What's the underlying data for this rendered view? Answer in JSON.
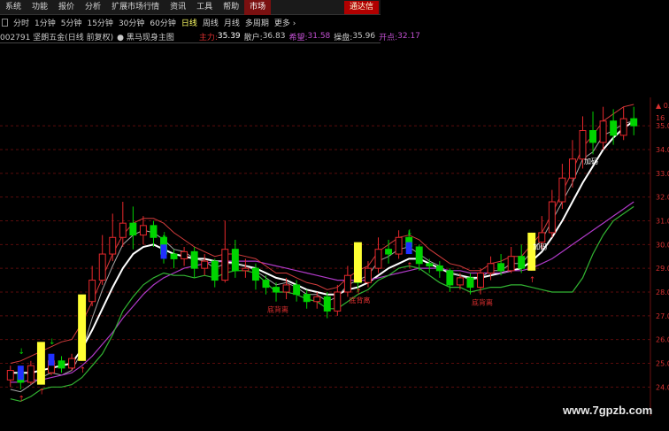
{
  "menu": {
    "items": [
      "系统",
      "功能",
      "报价",
      "分析",
      "扩展市场行情",
      "资讯",
      "工具",
      "帮助"
    ],
    "active": "市场",
    "right_link": "通达信"
  },
  "periods": {
    "items": [
      "分时",
      "1分钟",
      "5分钟",
      "15分钟",
      "30分钟",
      "60分钟",
      "日线",
      "周线",
      "月线",
      "多周期",
      "更多"
    ],
    "selected": "日线"
  },
  "info": {
    "code_name": "002791 坚朗五金(日线 前复权)",
    "indicator": "黑马现身主图",
    "zhuli_label": "主力:",
    "zhuli_value": "35.39",
    "sanhu_label": "散户:",
    "sanhu_value": "36.83",
    "xiwang_label": "希望:",
    "xiwang_value": "31.58",
    "caopan_label": "操盘:",
    "caopan_value": "35.96",
    "kaidian_label": "开点:",
    "kaidian_value": "32.17"
  },
  "colors": {
    "up": "#e8282c",
    "down": "#00d400",
    "highlight": "#ffff33",
    "main_line": "#ffffff",
    "mid_line": "#a9a9a9",
    "purple_line": "#b03ac8",
    "green_line": "#32b432",
    "red_line": "#d23c3c"
  },
  "chart_data": {
    "type": "candlestick",
    "ylim": [
      23.9,
      35.9
    ],
    "y_ticks": [
      "35.0",
      "34.0",
      "33.0",
      "32.0",
      "31.0",
      "30.0",
      "29.0",
      "28.0",
      "27.0",
      "26.0",
      "25.0",
      "24.0"
    ],
    "y_tick_values": [
      35,
      34,
      33,
      32,
      31,
      30,
      29,
      28,
      27,
      26,
      25,
      24
    ],
    "top_right_ticks": [
      "0.40",
      "16"
    ],
    "annotations": [
      {
        "text": "底背离",
        "i": 26
      },
      {
        "text": "底背离",
        "i": 34
      },
      {
        "text": "底背离",
        "i": 46
      },
      {
        "text": "加码",
        "i": 57
      },
      {
        "text": "加码",
        "i": 52
      }
    ],
    "candles": [
      [
        24.3,
        24.7,
        24.0,
        24.9
      ],
      [
        24.6,
        24.2,
        23.9,
        24.8
      ],
      [
        24.2,
        24.9,
        24.1,
        25.1
      ],
      [
        24.9,
        24.6,
        24.4,
        25.1
      ],
      [
        24.6,
        25.1,
        24.5,
        25.3
      ],
      [
        25.1,
        24.8,
        24.6,
        25.3
      ],
      [
        24.8,
        25.2,
        24.7,
        25.4
      ],
      [
        25.2,
        27.6,
        25.1,
        27.8
      ],
      [
        27.6,
        28.5,
        27.4,
        29.1
      ],
      [
        28.5,
        29.6,
        28.3,
        30.4
      ],
      [
        29.6,
        30.3,
        29.3,
        31.3
      ],
      [
        30.3,
        30.9,
        29.9,
        31.8
      ],
      [
        30.9,
        30.4,
        29.8,
        31.6
      ],
      [
        30.4,
        30.8,
        30.0,
        31.2
      ],
      [
        30.8,
        30.3,
        29.9,
        31.0
      ],
      [
        30.3,
        29.6,
        29.2,
        30.4
      ],
      [
        29.6,
        29.4,
        29.0,
        29.8
      ],
      [
        29.4,
        29.7,
        29.1,
        29.9
      ],
      [
        29.7,
        29.0,
        28.6,
        29.9
      ],
      [
        29.0,
        29.3,
        28.7,
        29.6
      ],
      [
        29.3,
        28.5,
        28.2,
        29.4
      ],
      [
        28.5,
        29.8,
        28.4,
        31.0
      ],
      [
        29.8,
        28.9,
        28.6,
        30.2
      ],
      [
        28.9,
        29.0,
        28.6,
        29.4
      ],
      [
        29.0,
        28.5,
        28.1,
        29.2
      ],
      [
        28.5,
        28.2,
        27.9,
        28.7
      ],
      [
        28.2,
        28.0,
        27.6,
        28.4
      ],
      [
        28.0,
        28.3,
        27.7,
        28.6
      ],
      [
        28.3,
        27.9,
        27.6,
        28.5
      ],
      [
        27.9,
        27.6,
        27.3,
        28.1
      ],
      [
        27.6,
        27.8,
        27.3,
        28.0
      ],
      [
        27.8,
        27.2,
        26.9,
        28.0
      ],
      [
        27.2,
        28.0,
        27.0,
        28.3
      ],
      [
        28.0,
        28.7,
        27.8,
        29.1
      ],
      [
        28.7,
        28.4,
        28.0,
        28.9
      ],
      [
        28.4,
        29.0,
        28.2,
        29.3
      ],
      [
        29.0,
        29.8,
        28.8,
        30.3
      ],
      [
        29.8,
        29.6,
        29.2,
        30.2
      ],
      [
        29.6,
        30.3,
        29.4,
        30.6
      ],
      [
        30.3,
        29.9,
        29.6,
        30.6
      ],
      [
        29.9,
        29.2,
        28.9,
        30.0
      ],
      [
        29.2,
        29.1,
        28.8,
        29.4
      ],
      [
        29.1,
        28.9,
        28.6,
        29.3
      ],
      [
        28.9,
        28.3,
        28.0,
        29.0
      ],
      [
        28.3,
        28.6,
        28.1,
        28.8
      ],
      [
        28.6,
        28.2,
        27.9,
        28.8
      ],
      [
        28.2,
        28.8,
        27.9,
        29.0
      ],
      [
        28.8,
        29.2,
        28.5,
        29.5
      ],
      [
        29.2,
        28.9,
        28.7,
        29.6
      ],
      [
        28.9,
        29.5,
        28.8,
        29.9
      ],
      [
        29.5,
        29.0,
        28.8,
        30.0
      ],
      [
        29.0,
        30.1,
        28.9,
        30.5
      ],
      [
        30.1,
        30.5,
        29.8,
        31.2
      ],
      [
        30.5,
        31.8,
        30.3,
        32.3
      ],
      [
        31.8,
        32.8,
        31.5,
        33.4
      ],
      [
        32.8,
        33.6,
        32.4,
        34.4
      ],
      [
        33.6,
        34.8,
        33.2,
        35.4
      ],
      [
        34.8,
        34.3,
        33.8,
        35.6
      ],
      [
        34.3,
        35.2,
        34.0,
        35.8
      ],
      [
        35.2,
        34.6,
        34.2,
        35.7
      ],
      [
        34.6,
        35.3,
        34.4,
        35.8
      ],
      [
        35.3,
        35.0,
        34.6,
        35.8
      ]
    ],
    "series": [
      {
        "name": "主力",
        "values": [
          24.6,
          24.6,
          24.6,
          24.7,
          24.8,
          24.9,
          25.0,
          25.6,
          26.4,
          27.3,
          28.2,
          29.0,
          29.6,
          29.9,
          30.0,
          29.8,
          29.6,
          29.5,
          29.4,
          29.4,
          29.3,
          29.3,
          29.2,
          29.1,
          29.0,
          28.8,
          28.6,
          28.5,
          28.3,
          28.1,
          28.0,
          27.9,
          27.9,
          28.1,
          28.2,
          28.4,
          28.7,
          29.0,
          29.2,
          29.4,
          29.4,
          29.2,
          29.0,
          28.8,
          28.7,
          28.6,
          28.6,
          28.7,
          28.8,
          28.9,
          29.0,
          29.3,
          29.7,
          30.3,
          31.0,
          31.8,
          32.6,
          33.3,
          34.0,
          34.5,
          34.9,
          35.2
        ]
      },
      {
        "name": "散户",
        "values": [
          23.9,
          23.8,
          24.1,
          24.4,
          24.6,
          24.5,
          24.7,
          25.5,
          26.9,
          28.1,
          29.1,
          30.0,
          30.4,
          30.6,
          30.5,
          30.2,
          29.8,
          29.7,
          29.4,
          29.3,
          29.0,
          29.2,
          29.2,
          29.1,
          28.9,
          28.6,
          28.3,
          28.4,
          28.2,
          27.9,
          27.9,
          27.6,
          27.8,
          28.3,
          28.5,
          28.7,
          29.3,
          29.5,
          29.8,
          29.9,
          29.6,
          29.3,
          29.1,
          28.8,
          28.7,
          28.5,
          28.6,
          28.9,
          28.9,
          29.2,
          29.2,
          29.7,
          30.2,
          31.0,
          31.8,
          32.6,
          33.6,
          33.9,
          34.6,
          34.8,
          35.1,
          35.2
        ]
      },
      {
        "name": "希望",
        "values": [
          24.2,
          24.2,
          24.3,
          24.3,
          24.4,
          24.5,
          24.6,
          24.9,
          25.3,
          25.8,
          26.3,
          26.9,
          27.4,
          27.9,
          28.3,
          28.6,
          28.8,
          29.0,
          29.1,
          29.2,
          29.3,
          29.3,
          29.3,
          29.3,
          29.3,
          29.2,
          29.1,
          29.0,
          28.9,
          28.8,
          28.7,
          28.6,
          28.5,
          28.5,
          28.5,
          28.5,
          28.6,
          28.7,
          28.8,
          28.9,
          29.0,
          29.0,
          29.0,
          28.9,
          28.9,
          28.8,
          28.8,
          28.8,
          28.8,
          28.9,
          28.9,
          29.0,
          29.2,
          29.4,
          29.7,
          30.0,
          30.3,
          30.6,
          30.9,
          31.2,
          31.5,
          31.8
        ]
      },
      {
        "name": "操盘",
        "values": [
          23.5,
          23.4,
          23.6,
          23.9,
          24.0,
          24.0,
          24.1,
          24.4,
          24.9,
          25.4,
          26.2,
          27.2,
          27.8,
          28.3,
          28.6,
          28.8,
          28.7,
          28.7,
          28.6,
          28.7,
          28.6,
          28.8,
          28.9,
          28.9,
          28.8,
          28.4,
          28.0,
          28.0,
          27.9,
          27.7,
          27.6,
          27.3,
          27.3,
          27.6,
          27.9,
          28.1,
          28.5,
          28.7,
          29.0,
          29.1,
          29.0,
          28.7,
          28.4,
          28.2,
          28.2,
          28.0,
          28.1,
          28.2,
          28.2,
          28.3,
          28.3,
          28.2,
          28.1,
          28.0,
          28.0,
          28.0,
          28.6,
          29.6,
          30.4,
          31.0,
          31.3,
          31.6
        ]
      },
      {
        "name": "开点",
        "values": [
          25.0,
          25.1,
          25.3,
          25.5,
          25.7,
          25.9,
          26.0,
          26.7,
          27.6,
          28.6,
          29.6,
          30.4,
          30.9,
          31.1,
          31.1,
          30.9,
          30.5,
          30.2,
          29.9,
          29.7,
          29.5,
          29.6,
          29.6,
          29.5,
          29.4,
          29.1,
          28.8,
          28.8,
          28.6,
          28.4,
          28.3,
          28.1,
          28.2,
          28.6,
          28.9,
          29.1,
          29.7,
          30.0,
          30.3,
          30.4,
          30.2,
          29.8,
          29.5,
          29.2,
          29.1,
          28.9,
          28.9,
          29.2,
          29.3,
          29.5,
          29.5,
          30.0,
          30.5,
          31.3,
          32.2,
          33.1,
          34.1,
          34.6,
          35.2,
          35.5,
          35.8,
          35.9
        ]
      }
    ]
  },
  "watermark": "www.7gpzb.com"
}
